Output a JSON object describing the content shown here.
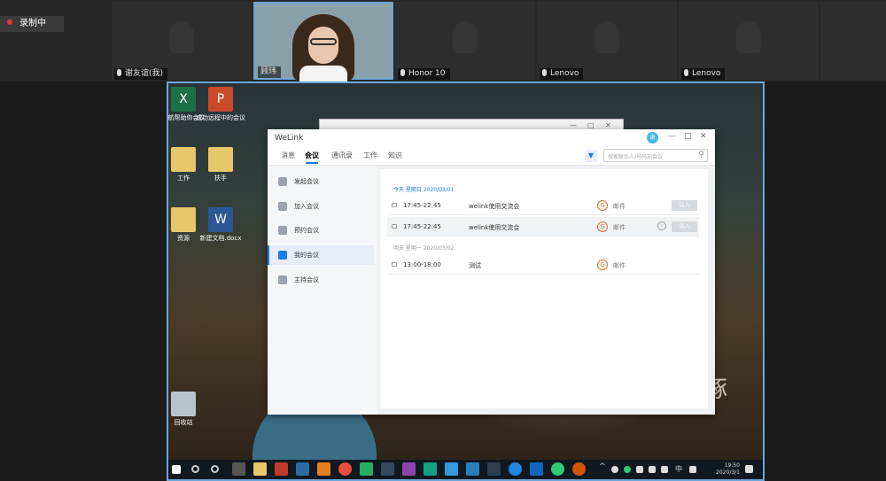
{
  "recording": {
    "label": "录制中"
  },
  "participants": [
    {
      "name": "谢友谊(我)"
    },
    {
      "name": "顾玮"
    },
    {
      "name": "Honor 10"
    },
    {
      "name": "Lenovo"
    },
    {
      "name": "Lenovo"
    }
  ],
  "desktop": {
    "icons": [
      {
        "label": "导航帮助你会议"
      },
      {
        "label": "成功远程中的会议"
      },
      {
        "label": "工作"
      },
      {
        "label": "扶手"
      },
      {
        "label": "资源"
      },
      {
        "label": "新建文档.docx"
      },
      {
        "label": "回收站"
      }
    ],
    "calligraphy": "琢",
    "taskbar": {
      "time": "19:50",
      "date": "2020/3/1",
      "lang": "中"
    }
  },
  "welink": {
    "title": "WeLink",
    "avatar": "谢",
    "tabs": [
      "消息",
      "会议",
      "通讯录",
      "工作",
      "知识"
    ],
    "search_placeholder": "搜索联系人/号码加会议",
    "sidebar": [
      "发起会议",
      "加入会议",
      "预约会议",
      "我的会议",
      "主持会议"
    ],
    "sections": [
      {
        "heading": "今天 星期日 2020/03/01",
        "rows": [
          {
            "time": "17:45-22:45",
            "name": "welink使用交流会",
            "tag": "邮件",
            "join": "加入"
          },
          {
            "time": "17:45-22:45",
            "name": "welink使用交流会",
            "tag": "邮件",
            "join": "加入"
          }
        ]
      },
      {
        "heading": "明天 星期一 2020/03/02",
        "rows": [
          {
            "time": "13:00-18:00",
            "name": "测试",
            "tag": "邮件"
          }
        ]
      }
    ]
  }
}
